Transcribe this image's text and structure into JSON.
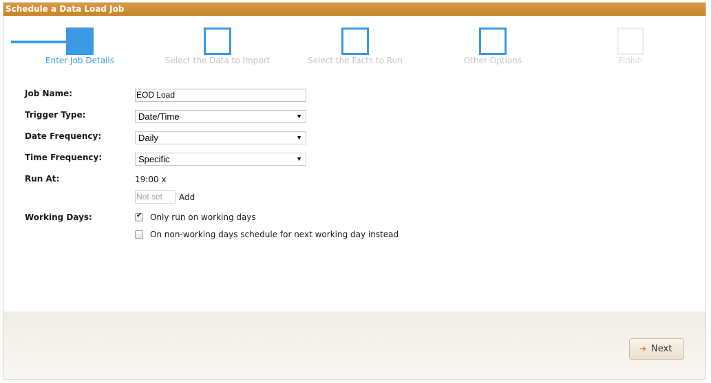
{
  "window": {
    "title": "Schedule a Data Load Job"
  },
  "wizard": {
    "steps": [
      {
        "label": "Enter Job Details",
        "state": "active"
      },
      {
        "label": "Select the Data to Import",
        "state": "pending"
      },
      {
        "label": "Select the Facts to Run",
        "state": "pending"
      },
      {
        "label": "Other Options",
        "state": "pending"
      },
      {
        "label": "Finish",
        "state": "disabled"
      }
    ]
  },
  "form": {
    "job_name_label": "Job Name:",
    "job_name_value": "EOD Load",
    "trigger_type_label": "Trigger Type:",
    "trigger_type_value": "Date/Time",
    "date_frequency_label": "Date Frequency:",
    "date_frequency_value": "Daily",
    "time_frequency_label": "Time Frequency:",
    "time_frequency_value": "Specific",
    "run_at_label": "Run At:",
    "run_at_time": "19:00",
    "run_at_remove": "x",
    "run_at_input_placeholder": "Not set",
    "add_label": "Add",
    "working_days_label": "Working Days:",
    "only_working_days_label": "Only run on working days",
    "only_working_days_checked": true,
    "next_working_day_label": "On non-working days schedule for next working day instead",
    "next_working_day_checked": false
  },
  "footer": {
    "next_label": "Next",
    "next_icon": "arrow-right-icon"
  },
  "colors": {
    "accent": "#3c99e4",
    "titlebar": "#d4923a",
    "next_arrow": "#e07b00"
  }
}
